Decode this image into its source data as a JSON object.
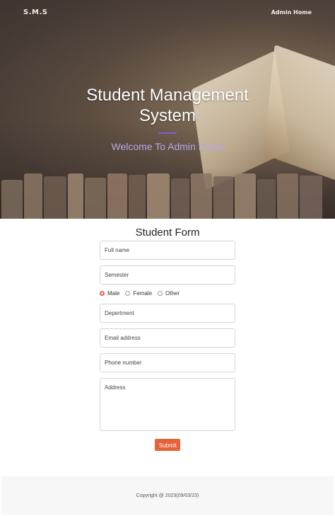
{
  "nav": {
    "brand": "S.M.S",
    "admin_home": "Admin Home"
  },
  "hero": {
    "title": "Student Management System",
    "subtitle": "Welcome To Admin Panel",
    "accent_color": "#7b5fd6"
  },
  "form": {
    "title": "Student Form",
    "full_name_placeholder": "Full name",
    "semester_placeholder": "Semester",
    "gender_options": [
      "Male",
      "Female",
      "Other"
    ],
    "gender_selected": "Male",
    "department_placeholder": "Depertment",
    "email_placeholder": "Email address",
    "phone_placeholder": "Phone number",
    "address_placeholder": "Address",
    "submit_label": "Submit",
    "accent_color": "#e4633b"
  },
  "footer": {
    "copyright": "Copyright @ 2023(09/03/23)"
  }
}
